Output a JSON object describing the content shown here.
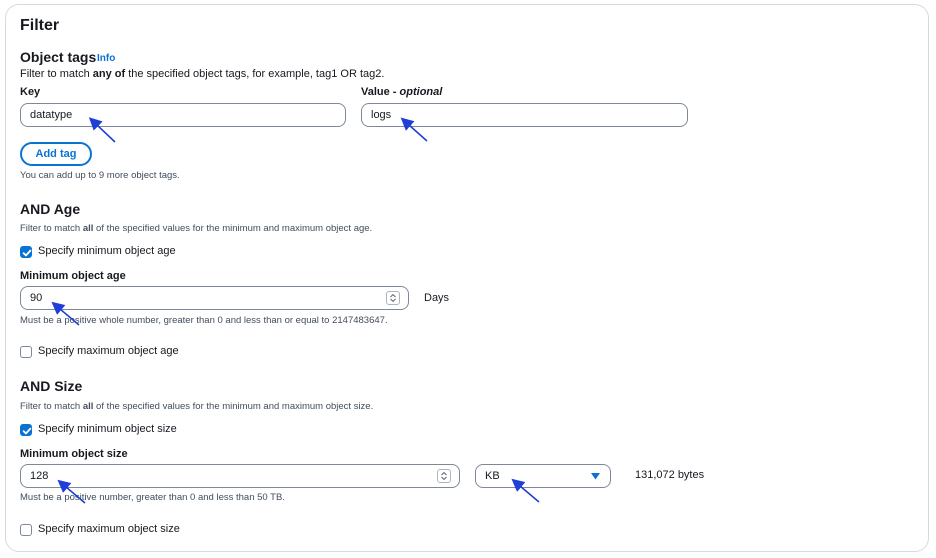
{
  "filter": {
    "title": "Filter",
    "object_tags": {
      "heading": "Object tags",
      "info_link": "Info",
      "desc_pre": "Filter to match ",
      "desc_bold": "any of",
      "desc_post": " the specified object tags, for example, tag1 OR tag2.",
      "key_label": "Key",
      "key_value": "datatype",
      "value_label": "Value - ",
      "value_label_optional": "optional",
      "value_value": "logs",
      "add_tag_label": "Add tag",
      "limit_hint": "You can add up to 9 more object tags."
    },
    "age": {
      "heading": "AND Age",
      "desc_pre": "Filter to match ",
      "desc_bold": "all",
      "desc_post": " of the specified values for the minimum and maximum object age.",
      "min_checkbox_label": "Specify minimum object age",
      "min_checked": true,
      "min_label": "Minimum object age",
      "min_value": "90",
      "min_unit": "Days",
      "min_hint": "Must be a positive whole number, greater than 0 and less than or equal to 2147483647.",
      "max_checkbox_label": "Specify maximum object age",
      "max_checked": false
    },
    "size": {
      "heading": "AND Size",
      "desc_pre": "Filter to match ",
      "desc_bold": "all",
      "desc_post": " of the specified values for the minimum and maximum object size.",
      "min_checkbox_label": "Specify minimum object size",
      "min_checked": true,
      "min_label": "Minimum object size",
      "min_value": "128",
      "unit_selected": "KB",
      "bytes_readout": "131,072 bytes",
      "min_hint": "Must be a positive number, greater than 0 and less than 50 TB.",
      "max_checkbox_label": "Specify maximum object size",
      "max_checked": false
    }
  },
  "colors": {
    "accent": "#0972d3",
    "annotation_arrow": "#1f3fd6",
    "border": "#7d8998"
  },
  "icons": {
    "checkbox_checked": "check-icon",
    "spinner": "spinner-icon",
    "dropdown": "caret-down-icon",
    "annotation": "arrow-annotation-icon"
  }
}
